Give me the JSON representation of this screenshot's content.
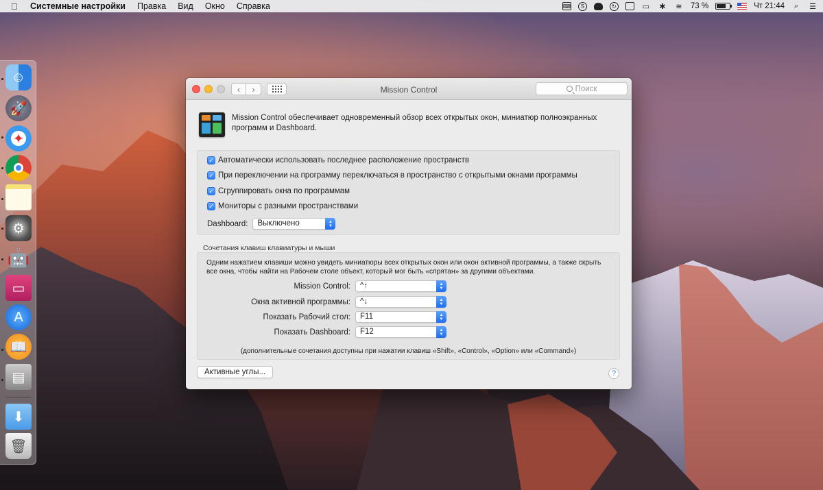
{
  "menubar": {
    "app_name": "Системные настройки",
    "items": [
      "Правка",
      "Вид",
      "Окно",
      "Справка"
    ],
    "battery_percent": "73 %",
    "battery_level": 0.73,
    "clock": "Чт 21:44",
    "status_icons": [
      "text-input-icon",
      "skype-icon",
      "hat-icon",
      "sync-icon",
      "box-icon",
      "airplay-icon",
      "bluetooth-icon",
      "wifi-icon",
      "battery-icon",
      "flag-us-icon",
      "search-icon",
      "list-icon"
    ]
  },
  "dock": {
    "apps": [
      "finder",
      "launchpad",
      "safari",
      "chrome",
      "notes",
      "system-preferences",
      "automator",
      "cleanmymac",
      "app-store",
      "ibooks",
      "preview",
      "downloads",
      "trash"
    ]
  },
  "window": {
    "title": "Mission Control",
    "search_placeholder": "Поиск",
    "description": "Mission Control обеспечивает одновременный обзор всех открытых окон, миниатюр полноэкранных программ и Dashboard.",
    "options": [
      {
        "label": "Автоматически использовать последнее расположение пространств",
        "checked": true
      },
      {
        "label": "При переключении на программу переключаться в пространство с открытыми окнами программы",
        "checked": true
      },
      {
        "label": "Сгруппировать окна по программам",
        "checked": true
      },
      {
        "label": "Мониторы с разными пространствами",
        "checked": true
      }
    ],
    "dashboard_label": "Dashboard:",
    "dashboard_value": "Выключено",
    "shortcuts_title": "Сочетания клавиш клавиатуры и мыши",
    "shortcuts_desc": "Одним нажатием клавиши можно увидеть миниатюры всех открытых окон или окон активной программы, а также скрыть все окна, чтобы найти на Рабочем столе объект, который мог быть «спрятан» за другими объектами.",
    "shortcuts": [
      {
        "label": "Mission Control:",
        "value": "^↑"
      },
      {
        "label": "Окна активной программы:",
        "value": "^↓"
      },
      {
        "label": "Показать Рабочий стол:",
        "value": "F11"
      },
      {
        "label": "Показать Dashboard:",
        "value": "F12"
      }
    ],
    "footnote": "(дополнительные сочетания доступны при нажатии клавиш «Shift», «Control», «Option» или «Command»)",
    "hot_corners_label": "Активные углы...",
    "help_label": "?"
  }
}
